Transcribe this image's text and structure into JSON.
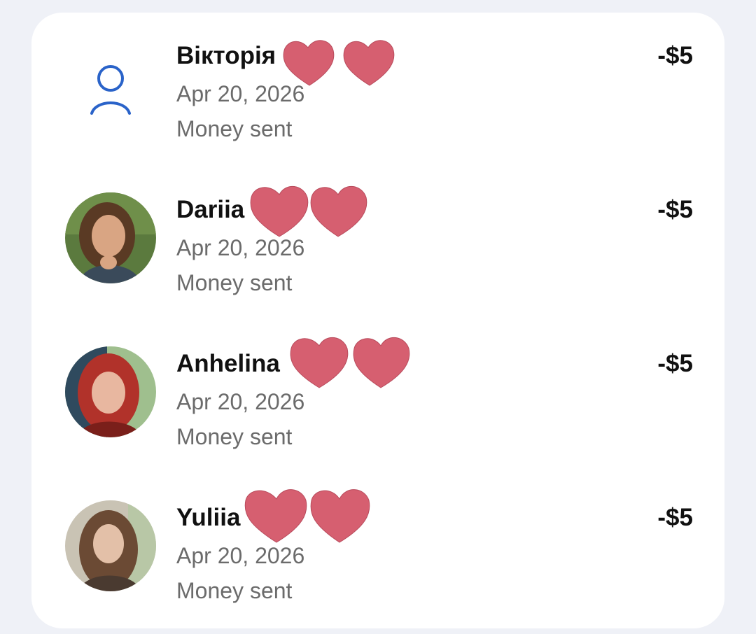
{
  "colors": {
    "page_bg": "#eff1f7",
    "card_bg": "#ffffff",
    "primary_text": "#111111",
    "secondary_text": "#6b6b6b",
    "accent_icon": "#2a63c9",
    "heart": "#d65f70"
  },
  "transactions": [
    {
      "name": "Вікторія",
      "date": "Apr 20, 2026",
      "status": "Money sent",
      "amount": "-$5",
      "avatar": "person-outline-icon"
    },
    {
      "name": "Dariia",
      "date": "Apr 20, 2026",
      "status": "Money sent",
      "amount": "-$5",
      "avatar": "photo"
    },
    {
      "name": "Anhelina",
      "date": "Apr 20, 2026",
      "status": "Money sent",
      "amount": "-$5",
      "avatar": "photo"
    },
    {
      "name": "Yuliia",
      "date": "Apr 20, 2026",
      "status": "Money sent",
      "amount": "-$5",
      "avatar": "photo"
    }
  ]
}
